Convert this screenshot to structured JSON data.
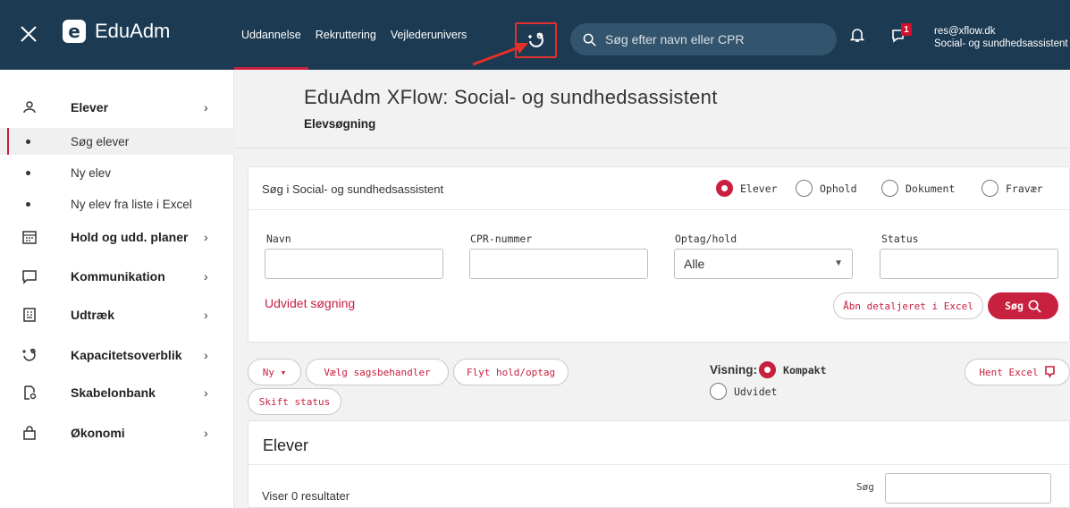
{
  "app": {
    "name": "EduAdm",
    "logo_letter": "e"
  },
  "topnav": {
    "items": [
      "Uddannelse",
      "Rekruttering",
      "Vejlederunivers"
    ]
  },
  "search": {
    "placeholder": "Søg efter navn eller CPR"
  },
  "notifications": {
    "chat_badge": "1"
  },
  "user": {
    "email": "res@xflow.dk",
    "role": "Social- og sundhedsassistent"
  },
  "sidebar": {
    "items": [
      {
        "label": "Elever",
        "icon": "person-icon"
      },
      {
        "label": "Hold og udd. planer",
        "icon": "calendar-icon"
      },
      {
        "label": "Kommunikation",
        "icon": "chat-icon"
      },
      {
        "label": "Udtræk",
        "icon": "document-list-icon"
      },
      {
        "label": "Kapacitetsoverblik",
        "icon": "capacity-icon"
      },
      {
        "label": "Skabelonbank",
        "icon": "template-icon"
      },
      {
        "label": "Økonomi",
        "icon": "shopping-bag-icon"
      }
    ],
    "subitems": [
      "Søg elever",
      "Ny elev",
      "Ny elev fra liste i Excel"
    ]
  },
  "page": {
    "title": "EduAdm XFlow: Social- og sundhedsassistent",
    "subtitle": "Elevsøgning"
  },
  "search_card": {
    "title": "Søg i Social- og sundhedsassistent",
    "radios": [
      "Elever",
      "Ophold",
      "Dokument",
      "Fravær"
    ],
    "selected_radio": "Elever",
    "fields": {
      "navn": "Navn",
      "cpr": "CPR-nummer",
      "optag": "Optag/hold",
      "status": "Status"
    },
    "optag_value": "Alle",
    "advanced_link": "Udvidet søgning",
    "excel_button": "Åbn detaljeret i Excel",
    "search_button": "Søg"
  },
  "actions": {
    "ny": "Ny ▾",
    "vaelg": "Vælg sagsbehandler",
    "flyt": "Flyt hold/optag",
    "skift": "Skift status",
    "visning_label": "Visning:",
    "kompakt": "Kompakt",
    "udvidet": "Udvidet",
    "hent_excel": "Hent Excel"
  },
  "results": {
    "heading": "Elever",
    "count_text": "Viser 0 resultater",
    "search_label": "Søg"
  },
  "colors": {
    "header": "#1c3a52",
    "accent": "#c8203f",
    "highlight": "#e2302a"
  }
}
